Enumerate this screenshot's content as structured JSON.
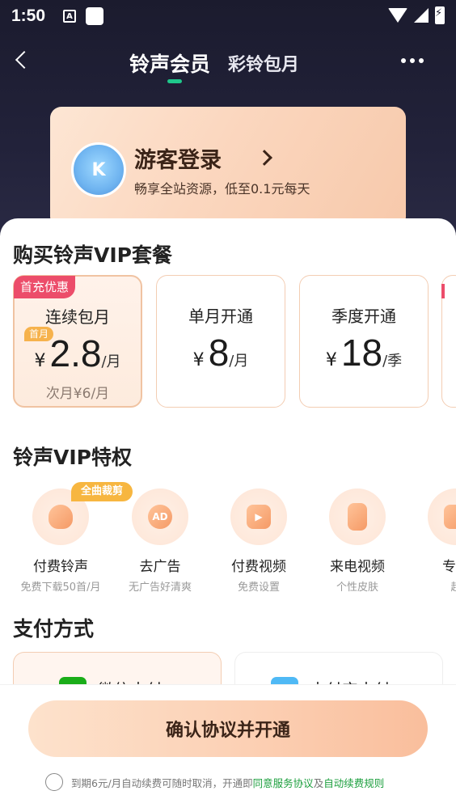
{
  "status_bar": {
    "time": "1:50",
    "notif_icon_letter": "A"
  },
  "nav": {
    "tab_active": "铃声会员",
    "tab_other": "彩铃包月"
  },
  "login": {
    "avatar_letter": "K",
    "title": "游客登录",
    "subtitle": "畅享全站资源，低至0.1元每天"
  },
  "plans_title": "购买铃声VIP套餐",
  "plans": [
    {
      "badge": "首充优惠",
      "name": "连续包月",
      "first_tag": "首月",
      "currency": "¥",
      "price": "2.8",
      "unit": "/月",
      "next": "次月¥6/月",
      "selected": true
    },
    {
      "name": "单月开通",
      "currency": "¥",
      "price": "8",
      "unit": "/月"
    },
    {
      "name": "季度开通",
      "currency": "¥",
      "price": "18",
      "unit": "/季"
    }
  ],
  "privileges_title": "铃声VIP特权",
  "privilege_tag": "全曲裁剪",
  "privileges": [
    {
      "icon": "bell-icon",
      "label": "付费铃声",
      "sub": "免费下载50首/月"
    },
    {
      "icon": "ad-icon",
      "icon_text": "AD",
      "label": "去广告",
      "sub": "无广告好清爽"
    },
    {
      "icon": "video-play-icon",
      "label": "付费视频",
      "sub": "免费设置"
    },
    {
      "icon": "phone-video-icon",
      "label": "来电视频",
      "sub": "个性皮肤"
    },
    {
      "icon": "exclusive-icon",
      "label": "专属",
      "sub": "超"
    }
  ],
  "payment_title": "支付方式",
  "payments": [
    {
      "icon": "wechat-pay-icon",
      "label": "微信支付",
      "color": "#1aad19",
      "selected": true
    },
    {
      "icon": "alipay-icon",
      "label": "支付宝支付",
      "color": "#4fb9f5"
    }
  ],
  "confirm_label": "确认协议并开通",
  "agreement": {
    "text1": "到期6元/月自动续费可随时取消，开通即",
    "link1": "同意服务协议",
    "and": "及",
    "link2": "自动续费规则"
  },
  "colors": {
    "accent_green": "#1fc78b",
    "badge_red": "#ec4d6a",
    "tag_orange": "#f7b640",
    "link_green": "#1a9e3c"
  }
}
